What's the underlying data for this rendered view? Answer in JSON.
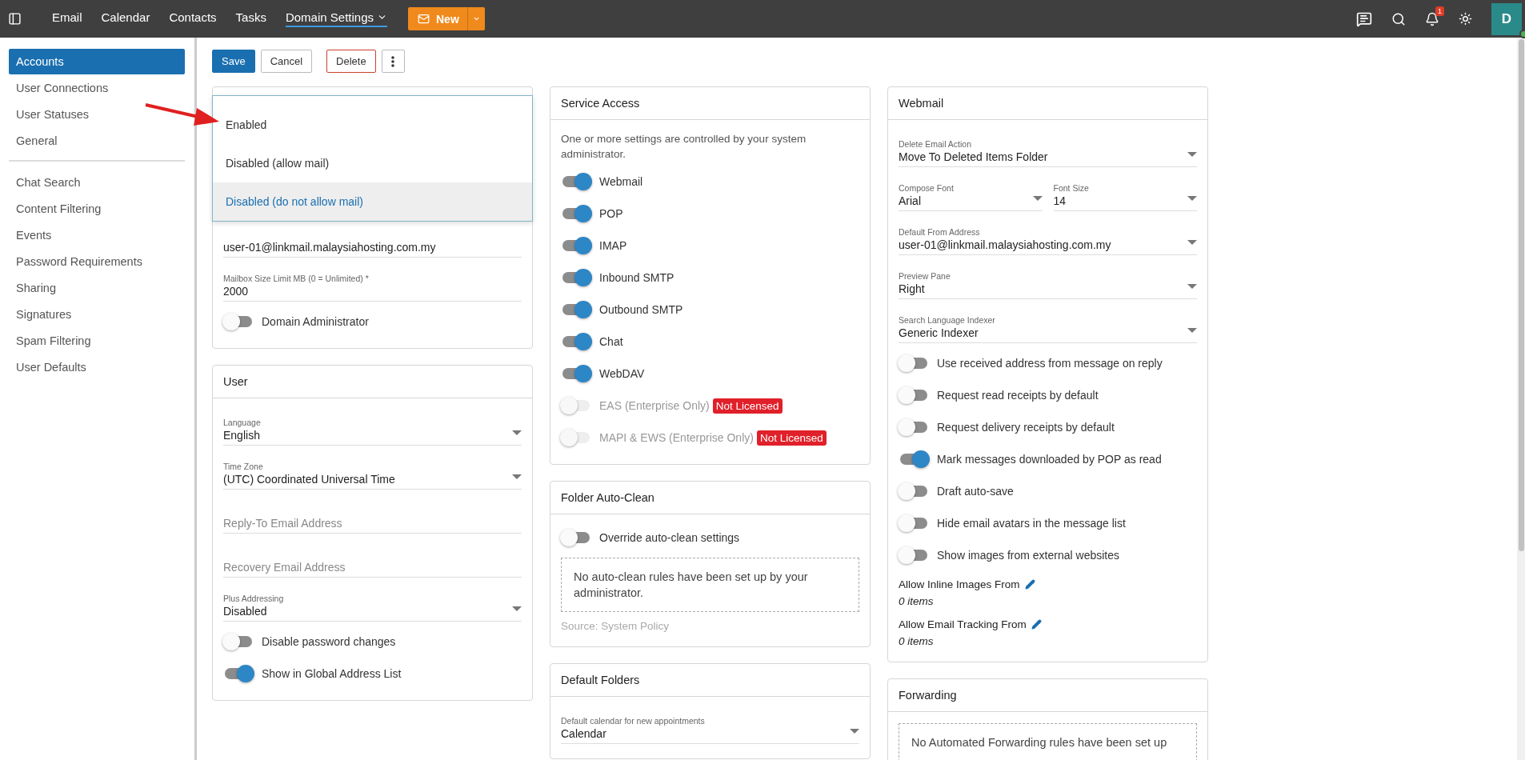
{
  "topbar": {
    "nav": [
      {
        "label": "Email",
        "selected": false
      },
      {
        "label": "Calendar",
        "selected": false
      },
      {
        "label": "Contacts",
        "selected": false
      },
      {
        "label": "Tasks",
        "selected": false
      },
      {
        "label": "Domain Settings",
        "selected": true,
        "menu": true
      }
    ],
    "new_button": "New",
    "notification_count": "1",
    "avatar": "D",
    "online": true
  },
  "sidebar": {
    "groups": [
      [
        {
          "label": "Accounts",
          "selected": true
        },
        {
          "label": "User Connections",
          "selected": false
        },
        {
          "label": "User Statuses",
          "selected": false
        },
        {
          "label": "General",
          "selected": false
        }
      ],
      [
        {
          "label": "Chat Search",
          "selected": false
        },
        {
          "label": "Content Filtering",
          "selected": false
        },
        {
          "label": "Events",
          "selected": false
        },
        {
          "label": "Password Requirements",
          "selected": false
        },
        {
          "label": "Sharing",
          "selected": false
        },
        {
          "label": "Signatures",
          "selected": false
        },
        {
          "label": "Spam Filtering",
          "selected": false
        },
        {
          "label": "User Defaults",
          "selected": false
        }
      ]
    ]
  },
  "toolbar": [
    {
      "label": "Save",
      "kind": "primary"
    },
    {
      "label": "Cancel",
      "kind": "default"
    },
    {
      "label": "Delete",
      "kind": "danger"
    },
    {
      "kind": "more"
    }
  ],
  "columns": [
    [
      {
        "dropdown": [
          {
            "label": "Enabled",
            "selected": false
          },
          {
            "label": "Disabled (allow mail)",
            "selected": false
          },
          {
            "label": "Disabled (do not allow mail)",
            "selected": true
          }
        ],
        "items": [
          {
            "kind": "input",
            "value": "user-01@linkmail.malaysiahosting.com.my"
          },
          {
            "kind": "input",
            "label": "Mailbox Size Limit MB (0 = Unlimited) *",
            "value": "2000"
          },
          {
            "kind": "toggle",
            "label": "Domain Administrator",
            "on": false
          }
        ]
      },
      {
        "title": "User",
        "items": [
          {
            "kind": "select",
            "label": "Language",
            "value": "English"
          },
          {
            "kind": "select",
            "label": "Time Zone",
            "value": "(UTC) Coordinated Universal Time"
          },
          {
            "kind": "input",
            "placeholder": "Reply-To Email Address"
          },
          {
            "kind": "input",
            "placeholder": "Recovery Email Address"
          },
          {
            "kind": "select",
            "label": "Plus Addressing",
            "value": "Disabled"
          },
          {
            "kind": "toggle",
            "label": "Disable password changes",
            "on": false
          },
          {
            "kind": "toggle",
            "label": "Show in Global Address List",
            "on": true
          }
        ]
      }
    ],
    [
      {
        "title": "Service Access",
        "items": [
          {
            "kind": "note",
            "text": "One or more settings are controlled by your system administrator."
          },
          {
            "kind": "toggle",
            "label": "Webmail",
            "on": true
          },
          {
            "kind": "toggle",
            "label": "POP",
            "on": true
          },
          {
            "kind": "toggle",
            "label": "IMAP",
            "on": true
          },
          {
            "kind": "toggle",
            "label": "Inbound SMTP",
            "on": true
          },
          {
            "kind": "toggle",
            "label": "Outbound SMTP",
            "on": true
          },
          {
            "kind": "toggle",
            "label": "Chat",
            "on": true
          },
          {
            "kind": "toggle",
            "label": "WebDAV",
            "on": true
          },
          {
            "kind": "toggle",
            "label": "EAS (Enterprise Only)",
            "on": false,
            "disabled": true,
            "badge": "Not Licensed"
          },
          {
            "kind": "toggle",
            "label": "MAPI & EWS (Enterprise Only)",
            "on": false,
            "disabled": true,
            "badge": "Not Licensed"
          }
        ]
      },
      {
        "title": "Folder Auto-Clean",
        "items": [
          {
            "kind": "toggle",
            "label": "Override auto-clean settings",
            "on": false
          },
          {
            "kind": "dashed",
            "text": "No auto-clean rules have been set up by your administrator."
          },
          {
            "kind": "source",
            "text": "Source: System Policy"
          }
        ]
      },
      {
        "title": "Default Folders",
        "items": [
          {
            "kind": "select",
            "label": "Default calendar for new appointments",
            "value": "Calendar"
          }
        ]
      }
    ],
    [
      {
        "title": "Webmail",
        "items": [
          {
            "kind": "select",
            "label": "Delete Email Action",
            "value": "Move To Deleted Items Folder"
          },
          {
            "kind": "pair",
            "fields": [
              {
                "label": "Compose Font",
                "value": "Arial"
              },
              {
                "label": "Font Size",
                "value": "14"
              }
            ]
          },
          {
            "kind": "select",
            "label": "Default From Address",
            "value": "user-01@linkmail.malaysiahosting.com.my"
          },
          {
            "kind": "select",
            "label": "Preview Pane",
            "value": "Right"
          },
          {
            "kind": "select",
            "label": "Search Language Indexer",
            "value": "Generic Indexer"
          },
          {
            "kind": "toggle",
            "label": "Use received address from message on reply",
            "on": false
          },
          {
            "kind": "toggle",
            "label": "Request read receipts by default",
            "on": false
          },
          {
            "kind": "toggle",
            "label": "Request delivery receipts by default",
            "on": false
          },
          {
            "kind": "toggle",
            "label": "Mark messages downloaded by POP as read",
            "on": true
          },
          {
            "kind": "toggle",
            "label": "Draft auto-save",
            "on": false
          },
          {
            "kind": "toggle",
            "label": "Hide email avatars in the message list",
            "on": false
          },
          {
            "kind": "toggle",
            "label": "Show images from external websites",
            "on": false
          },
          {
            "kind": "listing",
            "label": "Allow Inline Images From",
            "value": "0 items"
          },
          {
            "kind": "listing",
            "label": "Allow Email Tracking From",
            "value": "0 items"
          }
        ]
      },
      {
        "title": "Forwarding",
        "items": [
          {
            "kind": "dashed",
            "text": "No Automated Forwarding rules have been set up"
          }
        ]
      }
    ]
  ]
}
